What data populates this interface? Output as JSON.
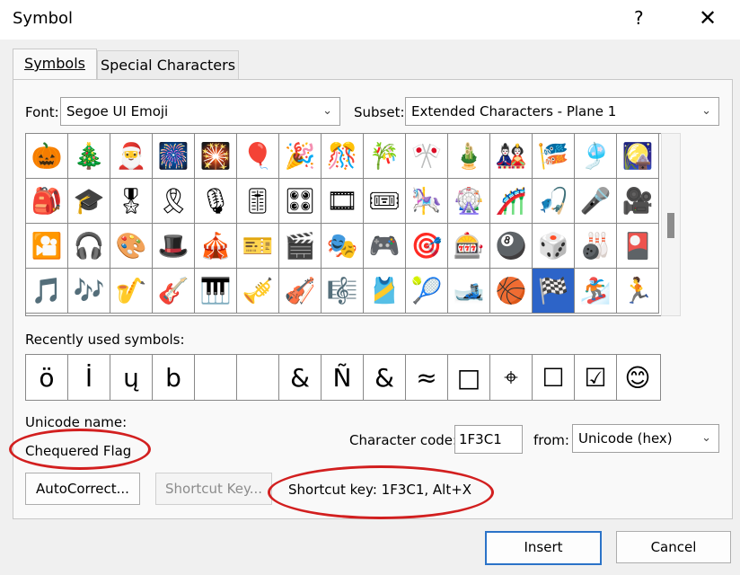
{
  "window": {
    "title": "Symbol",
    "help_glyph": "?",
    "close_glyph": "✕"
  },
  "tabs": [
    {
      "label": "Symbols",
      "active": true
    },
    {
      "label": "Special Characters",
      "active": false
    }
  ],
  "font": {
    "label": "Font:",
    "value": "Segoe UI Emoji"
  },
  "subset": {
    "label": "Subset:",
    "value": "Extended Characters - Plane 1"
  },
  "symbol_grid": [
    [
      "🎃",
      "🎄",
      "🎅",
      "🎆",
      "🎇",
      "🎈",
      "🎉",
      "🎊",
      "🎋",
      "🎌",
      "🎍",
      "🎎",
      "🎏",
      "🎐",
      "🎑"
    ],
    [
      "🎒",
      "🎓",
      "🎖",
      "🎗",
      "🎙",
      "🎚",
      "🎛",
      "🎞",
      "🎟",
      "🎠",
      "🎡",
      "🎢",
      "🎣",
      "🎤",
      "🎥"
    ],
    [
      "🎦",
      "🎧",
      "🎨",
      "🎩",
      "🎪",
      "🎫",
      "🎬",
      "🎭",
      "🎮",
      "🎯",
      "🎰",
      "🎱",
      "🎲",
      "🎳",
      "🎴"
    ],
    [
      "🎵",
      "🎶",
      "🎷",
      "🎸",
      "🎹",
      "🎺",
      "🎻",
      "🎼",
      "🎽",
      "🎾",
      "🎿",
      "🏀",
      "🏁",
      "🏂",
      "🏃"
    ]
  ],
  "selected_symbol": "🏁",
  "recently_used": {
    "label": "Recently used symbols:",
    "symbols": [
      "ö",
      "İ",
      "ų",
      "b",
      "",
      "",
      "&",
      "Ñ",
      "&",
      "≈",
      "□",
      "⌖",
      "☐",
      "☑",
      "😊"
    ]
  },
  "unicode_name": {
    "label": "Unicode name:",
    "value": "Chequered Flag"
  },
  "character_code": {
    "label": "Character code:",
    "value": "1F3C1"
  },
  "from": {
    "label": "from:",
    "value": "Unicode (hex)"
  },
  "buttons": {
    "autocorrect": "AutoCorrect...",
    "shortcut_key": "Shortcut Key...",
    "insert": "Insert",
    "cancel": "Cancel"
  },
  "shortcut_text": "Shortcut key: 1F3C1, Alt+X",
  "icons": {
    "dropdown": "chevron-down-icon",
    "close": "close-icon",
    "help": "help-icon"
  },
  "colors": {
    "selection": "#2d64c8",
    "annotation": "#d21f1f",
    "default_button_border": "#2b73c8"
  }
}
